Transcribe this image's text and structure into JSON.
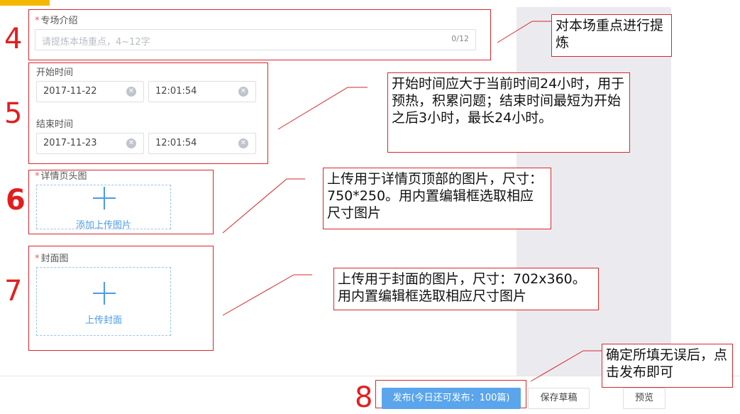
{
  "sections": {
    "intro": {
      "label": "专场介绍",
      "placeholder": "请提炼本场重点，4~12字",
      "counter": "0/12"
    },
    "time": {
      "start_label": "开始时间",
      "start_date": "2017-11-22",
      "start_time": "12:01:54",
      "end_label": "结束时间",
      "end_date": "2017-11-23",
      "end_time": "12:01:54"
    },
    "detail_header": {
      "label": "详情页头图",
      "upload_text": "添加上传图片"
    },
    "cover": {
      "label": "封面图",
      "upload_text": "上传封面"
    }
  },
  "footer": {
    "publish_label": "发布(今日还可发布：100篇)",
    "save_draft_label": "保存草稿",
    "preview_label": "预览"
  },
  "steps": [
    "4",
    "5",
    "6",
    "7",
    "8"
  ],
  "annotations": {
    "note4": "对本场重点进行提炼",
    "note5": "开始时间应大于当前时间24小时，用于预热，积累问题；结束时间最短为开始之后3小时，最长24小时。",
    "note6": "上传用于详情页顶部的图片，尺寸：750*250。用内置编辑框选取相应尺寸图片",
    "note7": "上传用于封面的图片，尺寸：702x360。用内置编辑框选取相应尺寸图片",
    "note8": "确定所填无误后，点击发布即可"
  },
  "colors": {
    "annotation_red": "#d9262c",
    "accent_blue": "#4a9be8",
    "primary_button": "#5aa5ec",
    "required_star": "#f25a5a"
  },
  "icons": {
    "clear": "circle-x",
    "upload": "plus"
  }
}
